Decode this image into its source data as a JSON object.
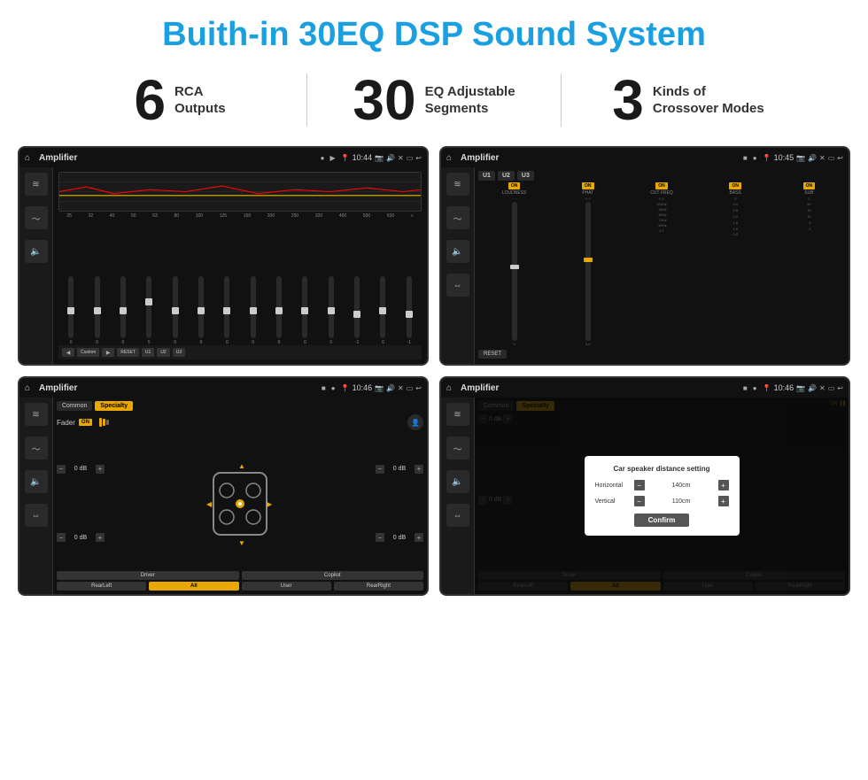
{
  "header": {
    "title": "Buith-in 30EQ DSP Sound System"
  },
  "stats": [
    {
      "number": "6",
      "text_line1": "RCA",
      "text_line2": "Outputs"
    },
    {
      "number": "30",
      "text_line1": "EQ Adjustable",
      "text_line2": "Segments"
    },
    {
      "number": "3",
      "text_line1": "Kinds of",
      "text_line2": "Crossover Modes"
    }
  ],
  "screen1": {
    "status_title": "Amplifier",
    "status_time": "10:44",
    "eq_labels": [
      "25",
      "32",
      "40",
      "50",
      "63",
      "80",
      "100",
      "125",
      "160",
      "200",
      "250",
      "320",
      "400",
      "500",
      "630"
    ],
    "eq_values": [
      "0",
      "0",
      "0",
      "5",
      "0",
      "0",
      "0",
      "0",
      "0",
      "0",
      "0",
      "-1",
      "0",
      "-1"
    ],
    "bottom_btns": [
      "Custom",
      "RESET",
      "U1",
      "U2",
      "U3"
    ]
  },
  "screen2": {
    "status_title": "Amplifier",
    "status_time": "10:45",
    "presets": [
      "U1",
      "U2",
      "U3"
    ],
    "controls": [
      "LOUDNESS",
      "PHAT",
      "CUT FREQ",
      "BASS",
      "SUB"
    ],
    "reset_label": "RESET"
  },
  "screen3": {
    "status_title": "Amplifier",
    "status_time": "10:46",
    "tabs": [
      "Common",
      "Specialty"
    ],
    "fader_label": "Fader",
    "fader_on": "ON",
    "control_labels": [
      "0 dB",
      "0 dB",
      "0 dB",
      "0 dB"
    ],
    "bottom_btns": [
      "Driver",
      "Copilot",
      "RearLeft",
      "All",
      "User",
      "RearRight"
    ]
  },
  "screen4": {
    "status_title": "Amplifier",
    "status_time": "10:46",
    "tabs": [
      "Common",
      "Specialty"
    ],
    "dialog": {
      "title": "Car speaker distance setting",
      "horizontal_label": "Horizontal",
      "horizontal_value": "140cm",
      "vertical_label": "Vertical",
      "vertical_value": "110cm",
      "confirm_label": "Confirm",
      "minus": "−",
      "plus": "+"
    },
    "control_labels": [
      "0 dB",
      "0 dB"
    ],
    "bottom_btns": [
      "Driver",
      "Copilot",
      "RearLeft",
      "User",
      "RearRight"
    ]
  },
  "icons": {
    "home": "⌂",
    "play": "▶",
    "pause": "⏸",
    "back": "↩",
    "location": "📍",
    "camera": "📷",
    "volume": "🔊",
    "x": "✕",
    "minus": "⬜",
    "eq": "≋",
    "wave": "〜",
    "speaker": "🔈",
    "arrows": "⇔",
    "gear": "⚙",
    "left": "◀",
    "right": "▶",
    "up": "▲",
    "down": "▼",
    "user": "👤"
  }
}
